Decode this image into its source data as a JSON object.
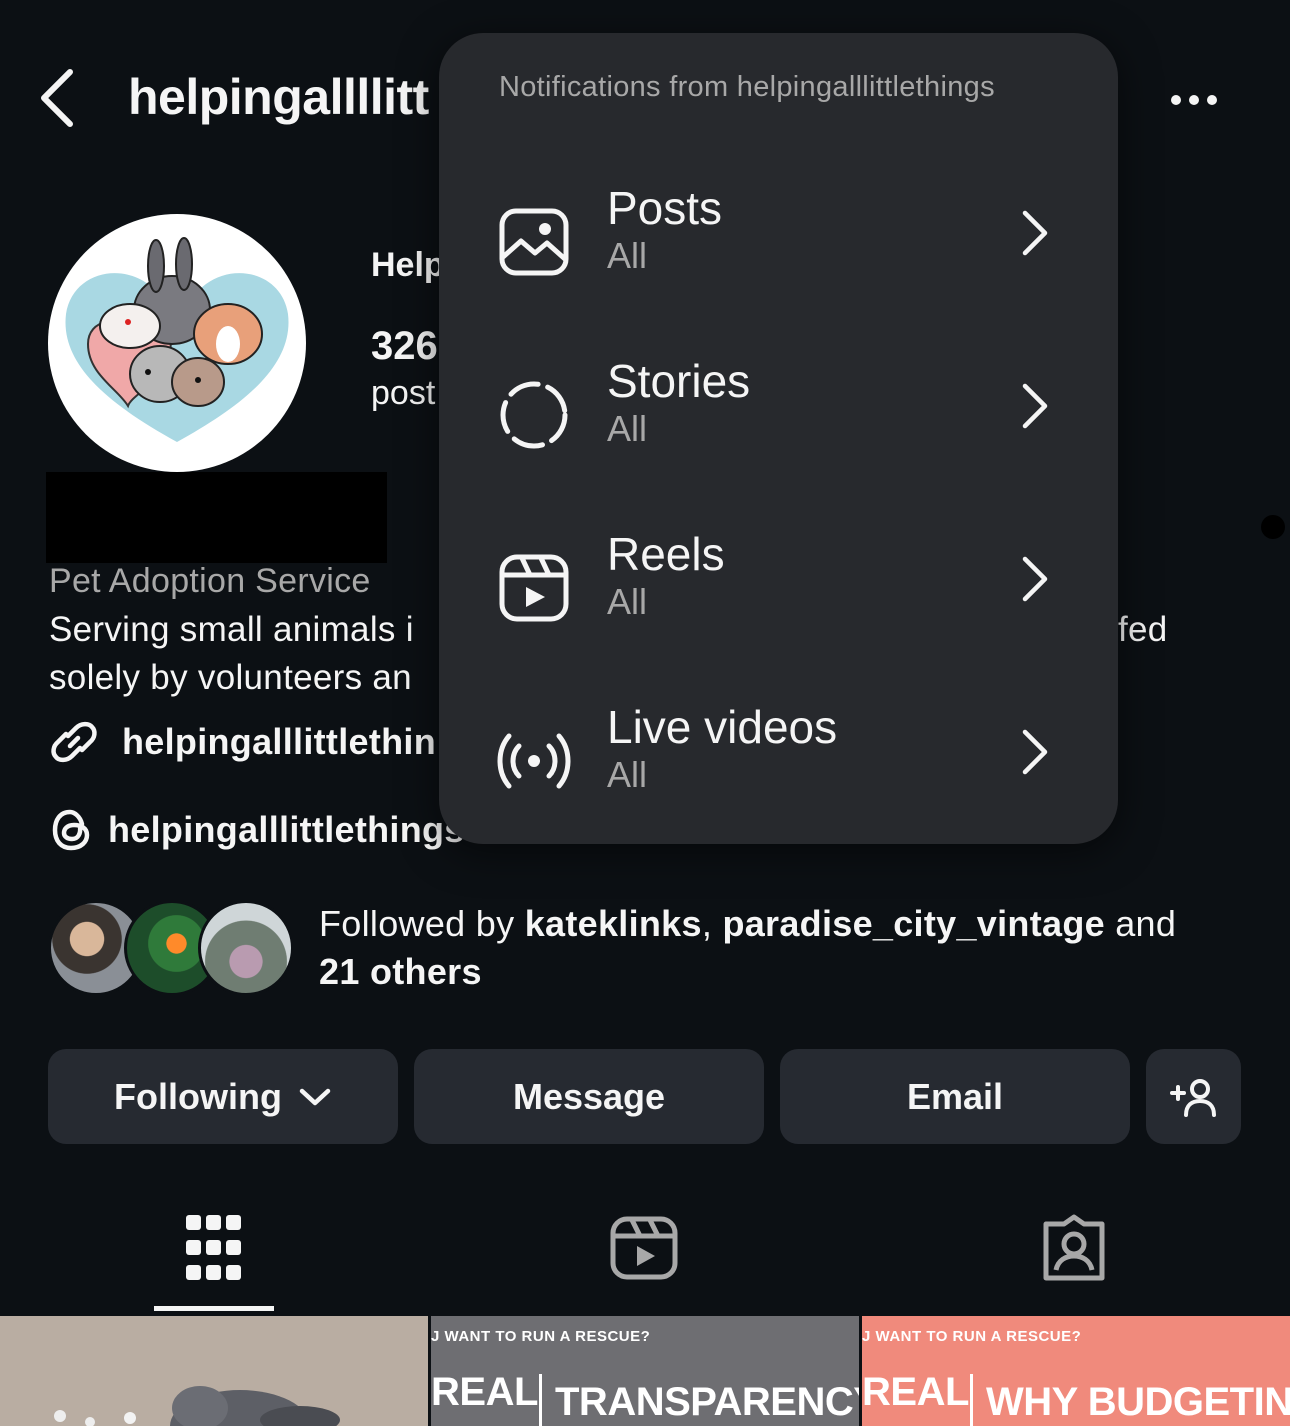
{
  "header": {
    "username": "helpingallllitt"
  },
  "profile": {
    "display_name": "Help",
    "stat_number": "326",
    "stat_label": "post",
    "category": "Pet Adoption Service",
    "bio_line1": "Serving small animals i",
    "bio_line1_tail": "fed",
    "bio_line2": "solely by volunteers an",
    "link": "helpingalllittlethin",
    "threads_handle": "helpingalllittlethings"
  },
  "followed_by": {
    "prefix": "Followed by ",
    "user1": "kateklinks",
    "sep": ", ",
    "user2": "paradise_city_vintage",
    "and": " and ",
    "others": "21 others"
  },
  "buttons": {
    "following": "Following",
    "message": "Message",
    "email": "Email"
  },
  "notifications": {
    "title": "Notifications from helpingalllittlethings",
    "items": [
      {
        "label": "Posts",
        "value": "All",
        "icon": "image-icon"
      },
      {
        "label": "Stories",
        "value": "All",
        "icon": "stories-dashed-circle-icon"
      },
      {
        "label": "Reels",
        "value": "All",
        "icon": "reels-icon"
      },
      {
        "label": "Live videos",
        "value": "All",
        "icon": "live-broadcast-icon"
      }
    ]
  },
  "thumbnails": [
    {
      "kicker": "",
      "big_a": "",
      "big_b": ""
    },
    {
      "kicker": "J WANT TO RUN A RESCUE?",
      "big_a": "REAL",
      "big_b": "TRANSPARENCY"
    },
    {
      "kicker": "J WANT TO RUN A RESCUE?",
      "big_a": "REAL",
      "big_b": "WHY BUDGETIN"
    }
  ],
  "colors": {
    "background": "#0c1014",
    "button": "#262a31",
    "popover": "#27292d",
    "secondary_text": "#a8a8a8"
  }
}
